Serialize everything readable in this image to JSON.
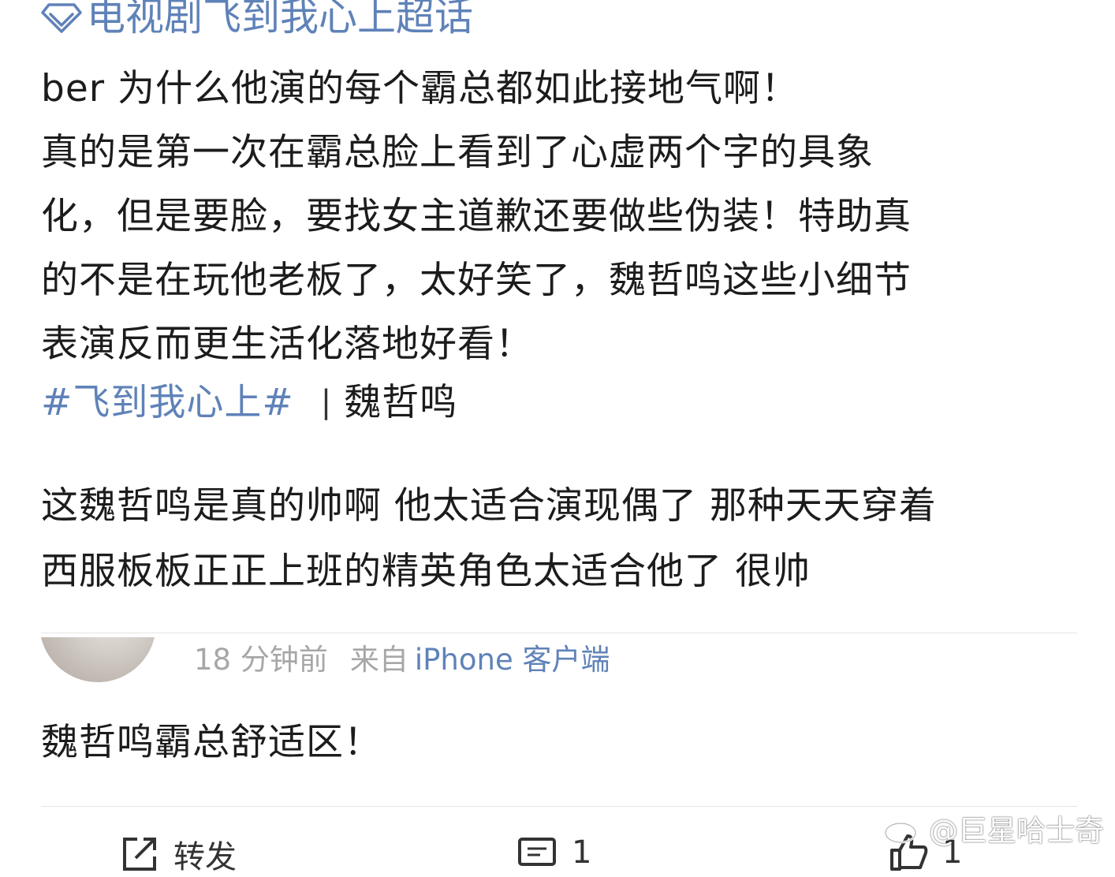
{
  "supertopic": {
    "label": "电视剧飞到我心上超话",
    "icon": "diamond-icon"
  },
  "post": {
    "lines": [
      "ber 为什么他演的每个霸总都如此接地气啊！",
      "真的是第一次在霸总脸上看到了心虚两个字的具象",
      "化，但是要脸，要找女主道歉还要做些伪装！特助真",
      "的不是在玩他老板了，太好笑了，魏哲鸣这些小细节",
      "表演反而更生活化落地好看！"
    ],
    "tag": "#飞到我心上#",
    "separator": "|",
    "mention": "魏哲鸣"
  },
  "comment": {
    "lines": [
      "这魏哲鸣是真的帅啊 他太适合演现偶了 那种天天穿着",
      "西服板板正正上班的精英角色太适合他了 很帅"
    ]
  },
  "meta": {
    "time": "18 分钟前",
    "from": "来自",
    "client": "iPhone 客户端"
  },
  "reply": {
    "text": "魏哲鸣霸总舒适区！"
  },
  "actions": {
    "repost_label": "转发",
    "comment_count": "1",
    "like_count": "1"
  },
  "watermark": {
    "text": "@巨星哈士奇",
    "icon": "weibo-logo-icon"
  },
  "colors": {
    "link": "#5f82b8",
    "text": "#1c1c1c",
    "meta": "#a7a7a7",
    "divider": "#e6e6e6"
  }
}
